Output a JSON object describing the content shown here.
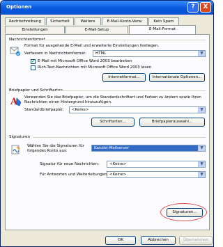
{
  "window": {
    "title": "Optionen",
    "help": "?",
    "close": "X"
  },
  "tabs": {
    "row1": [
      "Rechtschreibung",
      "Sicherheit",
      "Weitere",
      "E-Mail-Konto-Verw.",
      "Kein Spam"
    ],
    "row2": [
      "Einstellungen",
      "E-Mail-Setup",
      "E-Mail-Format"
    ],
    "active": "E-Mail-Format"
  },
  "format": {
    "heading": "Nachrichtenformat",
    "description": "Format für ausgehende E-Mail und erweiterte Einstellungen festlegen.",
    "compose_label": "Verfassen in Nachrichtenformat:",
    "compose_value": "HTML",
    "word_edit_label": "E-Mail mit Microsoft Office Word 2003 bearbeiten",
    "word_edit_checked": true,
    "word_read_label": "Rich-Text-Nachrichten mit Microsoft Office Word 2003 lesen",
    "word_read_checked": false,
    "internet_button": "Internetformat...",
    "intl_button": "Internationale Optionen..."
  },
  "stationery": {
    "heading": "Briefpapier und Schriftarten",
    "description": "Verwenden Sie das Briefpapier, um die Standardschriftart und Farben zu ändern sowie Ihren Nachrichten einen Hintergrund hinzuzufügen.",
    "default_label": "Standardbriefpapier:",
    "default_value": "<Keine>",
    "fonts_button": "Schriftarten...",
    "picker_button": "Briefpapierauswahl..."
  },
  "signatures": {
    "heading": "Signaturen",
    "description": "Wählen Sie die Signaturen für folgendes Konto aus:",
    "account_value": "Kanzlei-Mailserver",
    "new_label": "Signatur für neue Nachrichten:",
    "new_value": "<Keine>",
    "reply_label": "Für Antworten und Weiterleitungen:",
    "reply_value": "<Keine>",
    "button": "Signaturen..."
  },
  "footer": {
    "ok": "OK",
    "cancel": "Abbrechen",
    "apply": "Übernehmen"
  },
  "colors": {
    "title_blue": "#0a5ae0",
    "highlight_oval": "#e04a4a",
    "selection": "#316ac5"
  }
}
